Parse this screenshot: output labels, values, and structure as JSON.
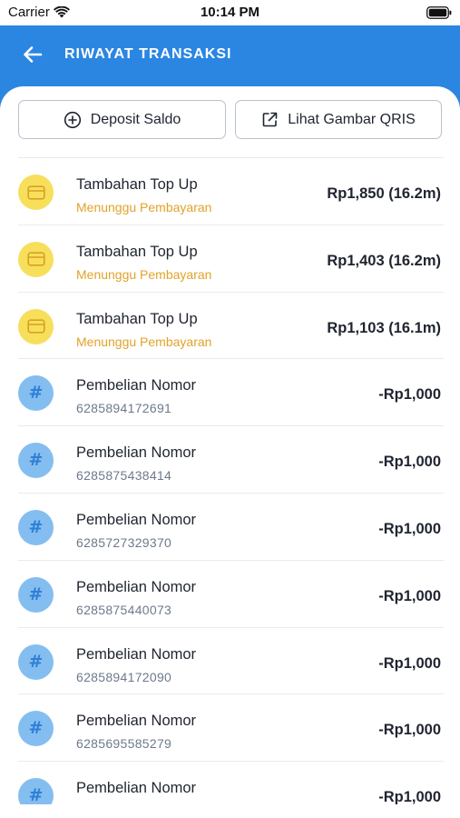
{
  "status_bar": {
    "carrier": "Carrier",
    "time": "10:14 PM"
  },
  "header": {
    "title": "RIWAYAT TRANSAKSI",
    "back_icon": "arrow-left-icon"
  },
  "actions": {
    "deposit_label": "Deposit Saldo",
    "deposit_icon": "plus-circle-icon",
    "qris_label": "Lihat Gambar QRIS",
    "qris_icon": "external-link-icon"
  },
  "colors": {
    "primary": "#2b86e2",
    "pending_text": "#e0a329",
    "topup_icon_bg": "#f7df5c",
    "purchase_icon_bg": "#84bef0"
  },
  "transactions": [
    {
      "type": "topup",
      "icon": "card-icon",
      "title": "Tambahan Top Up",
      "subtitle": "Menunggu Pembayaran",
      "amount": "Rp1,850 (16.2m)"
    },
    {
      "type": "topup",
      "icon": "card-icon",
      "title": "Tambahan Top Up",
      "subtitle": "Menunggu Pembayaran",
      "amount": "Rp1,403 (16.2m)"
    },
    {
      "type": "topup",
      "icon": "card-icon",
      "title": "Tambahan Top Up",
      "subtitle": "Menunggu Pembayaran",
      "amount": "Rp1,103 (16.1m)"
    },
    {
      "type": "purchase",
      "icon": "hash-icon",
      "title": "Pembelian Nomor",
      "subtitle": "6285894172691",
      "amount": "-Rp1,000"
    },
    {
      "type": "purchase",
      "icon": "hash-icon",
      "title": "Pembelian Nomor",
      "subtitle": "6285875438414",
      "amount": "-Rp1,000"
    },
    {
      "type": "purchase",
      "icon": "hash-icon",
      "title": "Pembelian Nomor",
      "subtitle": "6285727329370",
      "amount": "-Rp1,000"
    },
    {
      "type": "purchase",
      "icon": "hash-icon",
      "title": "Pembelian Nomor",
      "subtitle": "6285875440073",
      "amount": "-Rp1,000"
    },
    {
      "type": "purchase",
      "icon": "hash-icon",
      "title": "Pembelian Nomor",
      "subtitle": "6285894172090",
      "amount": "-Rp1,000"
    },
    {
      "type": "purchase",
      "icon": "hash-icon",
      "title": "Pembelian Nomor",
      "subtitle": "6285695585279",
      "amount": "-Rp1,000"
    },
    {
      "type": "purchase",
      "icon": "hash-icon",
      "title": "Pembelian Nomor",
      "subtitle": "",
      "amount": "-Rp1,000"
    }
  ]
}
